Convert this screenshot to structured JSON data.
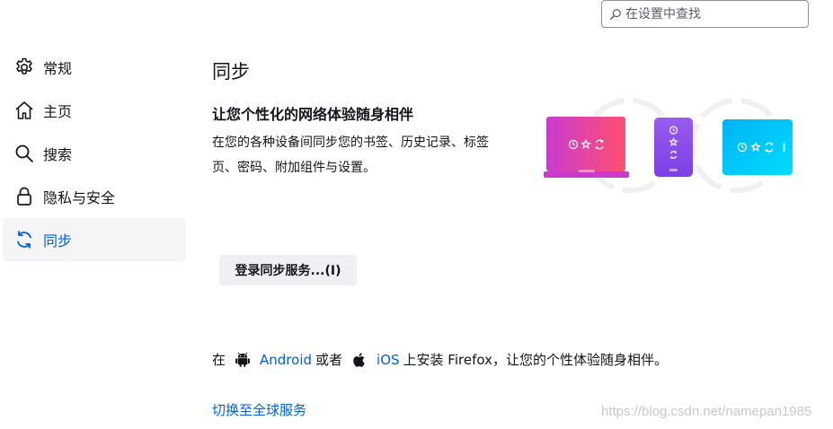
{
  "search": {
    "placeholder": "在设置中查找"
  },
  "sidebar": {
    "items": [
      {
        "label": "常规",
        "icon": "gear-icon"
      },
      {
        "label": "主页",
        "icon": "home-icon"
      },
      {
        "label": "搜索",
        "icon": "search-icon"
      },
      {
        "label": "隐私与安全",
        "icon": "lock-icon"
      },
      {
        "label": "同步",
        "icon": "sync-icon",
        "active": true
      }
    ]
  },
  "main": {
    "title": "同步",
    "hero_title": "让您个性化的网络体验随身相伴",
    "hero_desc": "在您的各种设备间同步您的书签、历史记录、标签页、密码、附加组件与设置。",
    "signin_button": "登录同步服务...(I)",
    "apps": {
      "prefix": "在",
      "android": "Android",
      "or": "或者",
      "ios": "iOS",
      "suffix": "上安装 Firefox，让您的个性体验随身相伴。"
    },
    "switch_link": "切换至全球服务"
  },
  "watermark": "https://blog.csdn.net/namepan1985",
  "colors": {
    "accent": "#0061e0",
    "active_bg": "#f5f5f7",
    "button_bg": "#f0f0f4"
  }
}
